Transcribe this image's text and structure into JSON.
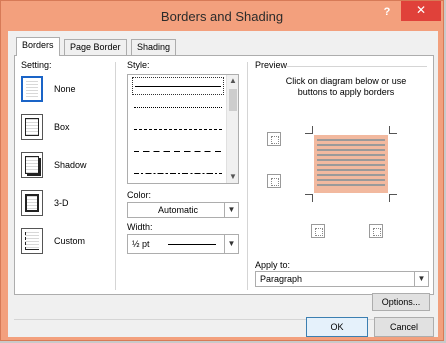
{
  "window": {
    "title": "Borders and Shading",
    "help": "?",
    "close": "✕"
  },
  "tabs": [
    {
      "label": "Borders",
      "active": true
    },
    {
      "label": "Page Border",
      "active": false
    },
    {
      "label": "Shading",
      "active": false
    }
  ],
  "setting": {
    "label": "Setting:",
    "items": [
      {
        "label": "None",
        "selected": true
      },
      {
        "label": "Box",
        "selected": false
      },
      {
        "label": "Shadow",
        "selected": false
      },
      {
        "label": "3-D",
        "selected": false
      },
      {
        "label": "Custom",
        "selected": false
      }
    ]
  },
  "style": {
    "label": "Style:"
  },
  "color": {
    "label": "Color:",
    "value": "Automatic"
  },
  "width": {
    "label": "Width:",
    "value": "½ pt"
  },
  "preview": {
    "label": "Preview",
    "instruction": "Click on diagram below or use buttons to apply borders"
  },
  "apply_to": {
    "label": "Apply to:",
    "value": "Paragraph"
  },
  "buttons": {
    "options": "Options...",
    "ok": "OK",
    "cancel": "Cancel"
  },
  "colors": {
    "accent": "#1a64c7",
    "title_bg": "#f3a07d",
    "close_bg": "#e0413a",
    "preview_fill": "#f2b99f"
  }
}
